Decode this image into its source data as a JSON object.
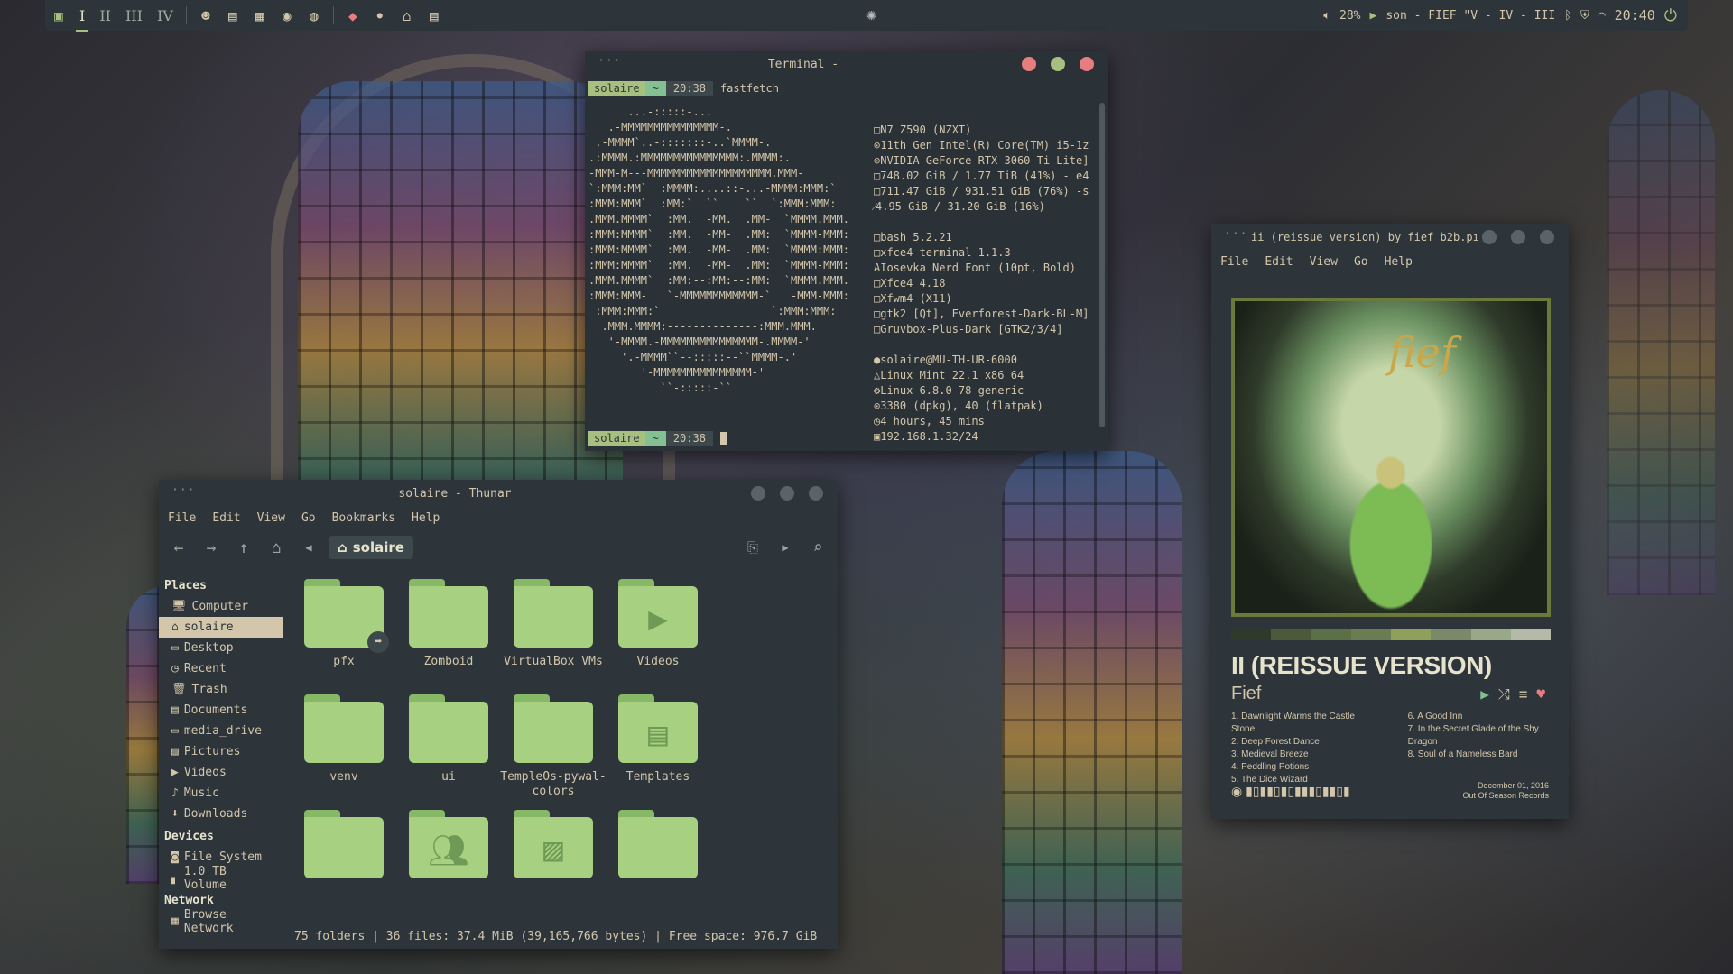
{
  "panel": {
    "workspaces": [
      "I",
      "II",
      "III",
      "IV"
    ],
    "volume": "28%",
    "now_playing": "son - FIEF \"V - IV - III",
    "clock": "20:40"
  },
  "terminal": {
    "title": "Terminal -",
    "user": "solaire",
    "dir": "~",
    "time": "20:38",
    "command": "fastfetch",
    "logo": "      ...-:::::-...\n   .-MMMMMMMMMMMMMMM-.\n .-MMMM`..-:::::::-..`MMMM-.\n.:MMMM.:MMMMMMMMMMMMMMM:.MMMM:.\n-MMM-M---MMMMMMMMMMMMMMMMMMM.MMM-\n`:MMM:MM`  :MMMM:....::-...-MMMM:MMM:`\n:MMM:MMM`  :MM:`  ``    ``  `:MMM:MMM:\n.MMM.MMMM`  :MM.  -MM.  .MM-  `MMMM.MMM.\n:MMM:MMMM`  :MM.  -MM-  .MM:  `MMMM-MMM:\n:MMM:MMMM`  :MM.  -MM-  .MM:  `MMMM:MMM:\n:MMM:MMMM`  :MM.  -MM-  .MM:  `MMMM-MMM:\n.MMM.MMMM`  :MM:--:MM:--:MM:  `MMMM.MMM.\n:MMM:MMM-   `-MMMMMMMMMMMM-`   -MMM-MMM:\n :MMM:MMM:`                 `:MMM:MMM:\n  .MMM.MMMM:--------------:MMM.MMM.\n   '-MMMM.-MMMMMMMMMMMMMMM-.MMMM-'\n     '.-MMMM``--:::::--``MMMM-.'\n        '-MMMMMMMMMMMMMMM-'\n           ``-:::::-``",
    "info_hw": [
      "N7 Z590 (NZXT)",
      "11th Gen Intel(R) Core(TM) i5-1z",
      "NVIDIA GeForce RTX 3060 Ti Lite]",
      "748.02 GiB / 1.77 TiB (41%) - e4",
      "711.47 GiB / 931.51 GiB (76%) -s",
      "4.95 GiB / 31.20 GiB (16%)"
    ],
    "info_sw": [
      "bash 5.2.21",
      "xfce4-terminal 1.1.3",
      "Iosevka Nerd Font (10pt, Bold)",
      "Xfce4 4.18",
      "Xfwm4 (X11)",
      "gtk2 [Qt], Everforest-Dark-BL-M]",
      "Gruvbox-Plus-Dark [GTK2/3/4]"
    ],
    "info_sys": [
      "solaire@MU-TH-UR-6000",
      "Linux Mint 22.1 x86_64",
      "Linux 6.8.0-78-generic",
      "3380 (dpkg), 40 (flatpak)",
      "4 hours, 45 mins",
      "192.168.1.32/24"
    ]
  },
  "thunar": {
    "title": "solaire - Thunar",
    "menu": [
      "File",
      "Edit",
      "View",
      "Go",
      "Bookmarks",
      "Help"
    ],
    "crumb": "solaire",
    "places_header": "Places",
    "places": [
      "Computer",
      "solaire",
      "Desktop",
      "Recent",
      "Trash",
      "Documents",
      "media_drive",
      "Pictures",
      "Videos",
      "Music",
      "Downloads"
    ],
    "devices_header": "Devices",
    "devices": [
      "File System",
      "1.0 TB Volume"
    ],
    "network_header": "Network",
    "network": [
      "Browse Network"
    ],
    "folders": [
      {
        "name": "pfx",
        "emblem": "link-icon"
      },
      {
        "name": "Zomboid",
        "emblem": ""
      },
      {
        "name": "VirtualBox VMs",
        "emblem": ""
      },
      {
        "name": "Videos",
        "emblem": "video-icon"
      },
      {
        "name": "venv",
        "emblem": ""
      },
      {
        "name": "ui",
        "emblem": ""
      },
      {
        "name": "TempleOs-pywal-colors",
        "emblem": ""
      },
      {
        "name": "Templates",
        "emblem": "template-icon"
      },
      {
        "name": "",
        "emblem": ""
      },
      {
        "name": "",
        "emblem": "users-icon"
      },
      {
        "name": "",
        "emblem": "image-icon"
      },
      {
        "name": "",
        "emblem": ""
      }
    ],
    "status": "75 folders  |  36 files: 37.4 MiB (39,165,766 bytes)  |  Free space: 976.7 GiB"
  },
  "player": {
    "title": "ii_(reissue_version)_by_fief_b2b.pı",
    "menu": [
      "File",
      "Edit",
      "View",
      "Go",
      "Help"
    ],
    "cover_text": "fief",
    "album": "II (REISSUE VERSION)",
    "artist": "Fief",
    "tracks_left": [
      "1. Dawnlight Warms the Castle Stone",
      "2. Deep Forest Dance",
      "3. Medieval Breeze",
      "4. Peddling Potions",
      "5. The Dice Wizard"
    ],
    "tracks_right": [
      "6. A Good Inn",
      "7. In the Secret Glade of the Shy Dragon",
      "8. Soul of a Nameless Bard"
    ],
    "date": "December 01, 2016",
    "label": "Out Of Season Records",
    "palette": [
      "#2f3a2a",
      "#4a5a3a",
      "#5c7048",
      "#6a7d52",
      "#8ea05a",
      "#7a8a68",
      "#9aa88a",
      "#b4b9a8"
    ]
  },
  "colors": {
    "accent": "#a7c080",
    "bg": "#2d353b",
    "close": "#e67e80",
    "min": "#a7c080"
  }
}
